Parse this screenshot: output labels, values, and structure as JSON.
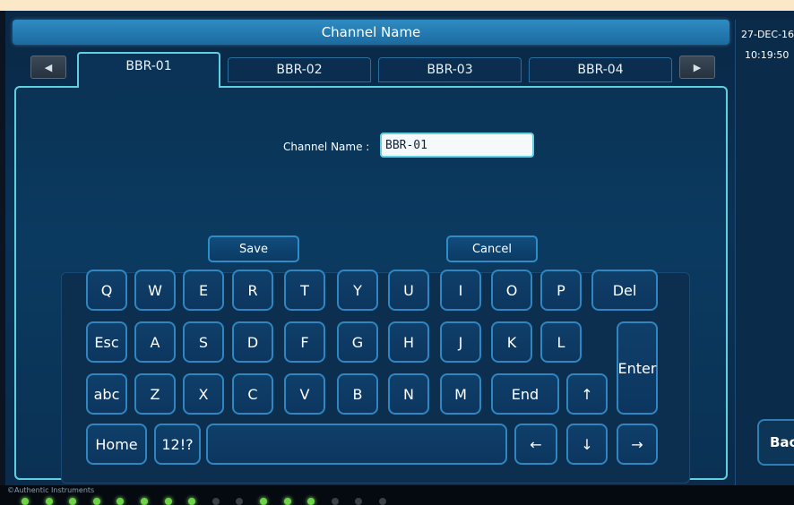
{
  "title": "Channel Name",
  "side": {
    "date": "27-DEC-16",
    "time": "10:19:50",
    "back_label": "Back"
  },
  "tabs": {
    "prev_icon": "◀",
    "next_icon": "▶",
    "items": [
      "BBR-01",
      "BBR-02",
      "BBR-03",
      "BBR-04"
    ],
    "active": "BBR-01"
  },
  "form": {
    "label": "Channel Name :",
    "value": "BBR-01"
  },
  "actions": {
    "save_label": "Save",
    "cancel_label": "Cancel"
  },
  "keyboard": {
    "row1": [
      "Q",
      "W",
      "E",
      "R",
      "T",
      "Y",
      "U",
      "I",
      "O",
      "P",
      "Del"
    ],
    "row2": [
      "Esc",
      "A",
      "S",
      "D",
      "F",
      "G",
      "H",
      "J",
      "K",
      "L"
    ],
    "row3": [
      "abc",
      "Z",
      "X",
      "C",
      "V",
      "B",
      "N",
      "M",
      "End",
      "↑"
    ],
    "row4": [
      "Home",
      "12!?",
      "",
      "←",
      "↓",
      "→"
    ],
    "enter_label": "Enter"
  },
  "footer": {
    "copyright": "©Authentic Instruments"
  },
  "leds": {
    "states": [
      true,
      true,
      true,
      true,
      true,
      true,
      true,
      true,
      false,
      false,
      true,
      true,
      true,
      false,
      false,
      false
    ]
  },
  "colors": {
    "accent": "#5fd0e0",
    "title_bar": "#2278ae",
    "led_on": "#6fd34a",
    "led_off": "#3a4046"
  }
}
